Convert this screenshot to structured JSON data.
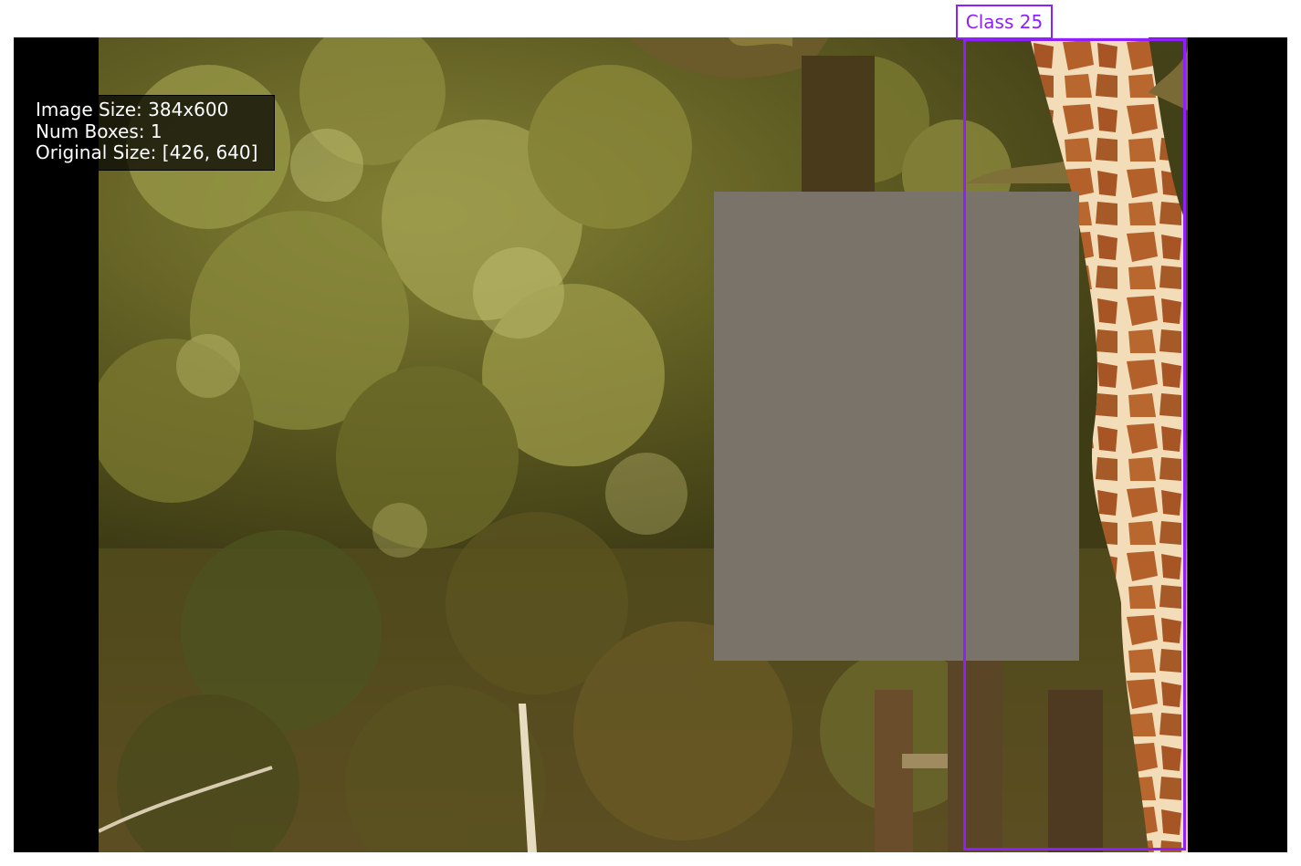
{
  "info": {
    "image_size": "Image Size: 384x600",
    "num_boxes": "Num Boxes: 1",
    "original_size": "Original Size: [426, 640]"
  },
  "annotation": {
    "label": "Class 25",
    "color": "#8f1fff"
  },
  "scene": {
    "description_icon": "giraffe-beside-trees",
    "occlusion_color": "#7a7369",
    "foliage_color": "#6b6a2c",
    "giraffe_color": "#b8672e"
  }
}
